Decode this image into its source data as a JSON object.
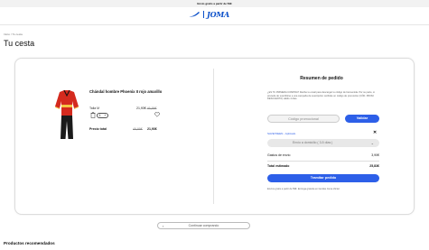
{
  "promo_bar": {
    "text": "Envío gratis a partir de 59€"
  },
  "brand": {
    "name": "JOMA",
    "accent": "#0a4fc9"
  },
  "breadcrumb": "Inicio / Tu cesta",
  "page_title": "Tu cesta",
  "cart_item": {
    "image_icon": "tracksuit-image",
    "name": "Chándal hombre Phoenix II rojo amarillo",
    "size": "Talla M",
    "price_new": "21,93€",
    "price_old": "46,99€",
    "quantity": "1",
    "total_label": "Precio total",
    "total_old": "46,99€",
    "total_new": "21,93€"
  },
  "summary": {
    "title": "Resumen de pedido",
    "promo_note": "¿ES TU PRIMERA COMPRA? Recibe tu email para descargar tu código de bienvenida. Por su parte, si procede de suscribirse a una campaña de suscripción recibirás un código de promoción (CÓD. PROM. DESCUENTO) válido 4 días.",
    "promo_placeholder": "Código promocional",
    "validate_label": "Validar",
    "applied_code": "SAVE70EEN - Aplicado",
    "shipping_option": "Envío a domicilio ( 3-5 días )",
    "shipping_label": "Gastos de envío",
    "shipping_value": "3,90€",
    "total_label": "Total estimado",
    "total_value": "25,83€",
    "checkout_label": "Tramitar pedido",
    "free_ship_note": "Envíos gratis a partir de 59€. Entrega gratuita en tiendas Joma oficial."
  },
  "continue_label": "Continuar comprando",
  "recommended_title": "Productos recomendados",
  "colors": {
    "accent": "#2d5fe8",
    "jacket_red": "#d42a1e",
    "jacket_yellow": "#f4c542"
  }
}
